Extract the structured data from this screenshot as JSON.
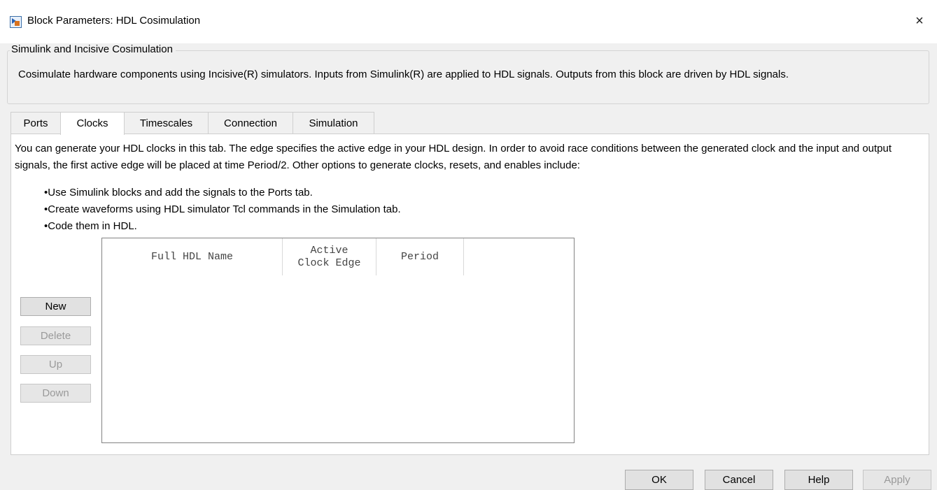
{
  "window": {
    "title": "Block Parameters: HDL Cosimulation",
    "close_icon": "×"
  },
  "group": {
    "title": "Simulink and Incisive Cosimulation",
    "description": "Cosimulate hardware components using Incisive(R) simulators.  Inputs from Simulink(R) are applied to HDL signals.  Outputs from this block are driven by HDL signals."
  },
  "tabs": [
    {
      "label": "Ports"
    },
    {
      "label": "Clocks"
    },
    {
      "label": "Timescales"
    },
    {
      "label": "Connection"
    },
    {
      "label": "Simulation"
    }
  ],
  "active_tab": "Clocks",
  "clocks": {
    "intro": "You can generate your HDL clocks in this tab. The edge specifies the active edge in your HDL design. In order to avoid race conditions between the generated clock and the input and output signals, the first active edge will be placed at time Period/2. Other options to generate clocks, resets, and enables include:",
    "bullets": [
      "Use Simulink blocks and add the signals to the Ports tab.",
      "Create waveforms using HDL simulator Tcl commands in the Simulation tab.",
      "Code them in HDL."
    ],
    "buttons": {
      "new": "New",
      "delete": "Delete",
      "up": "Up",
      "down": "Down"
    },
    "table": {
      "columns": [
        "Full HDL Name",
        "Active\nClock Edge",
        "Period"
      ],
      "rows": []
    }
  },
  "footer": {
    "ok": "OK",
    "cancel": "Cancel",
    "help": "Help",
    "apply": "Apply"
  }
}
